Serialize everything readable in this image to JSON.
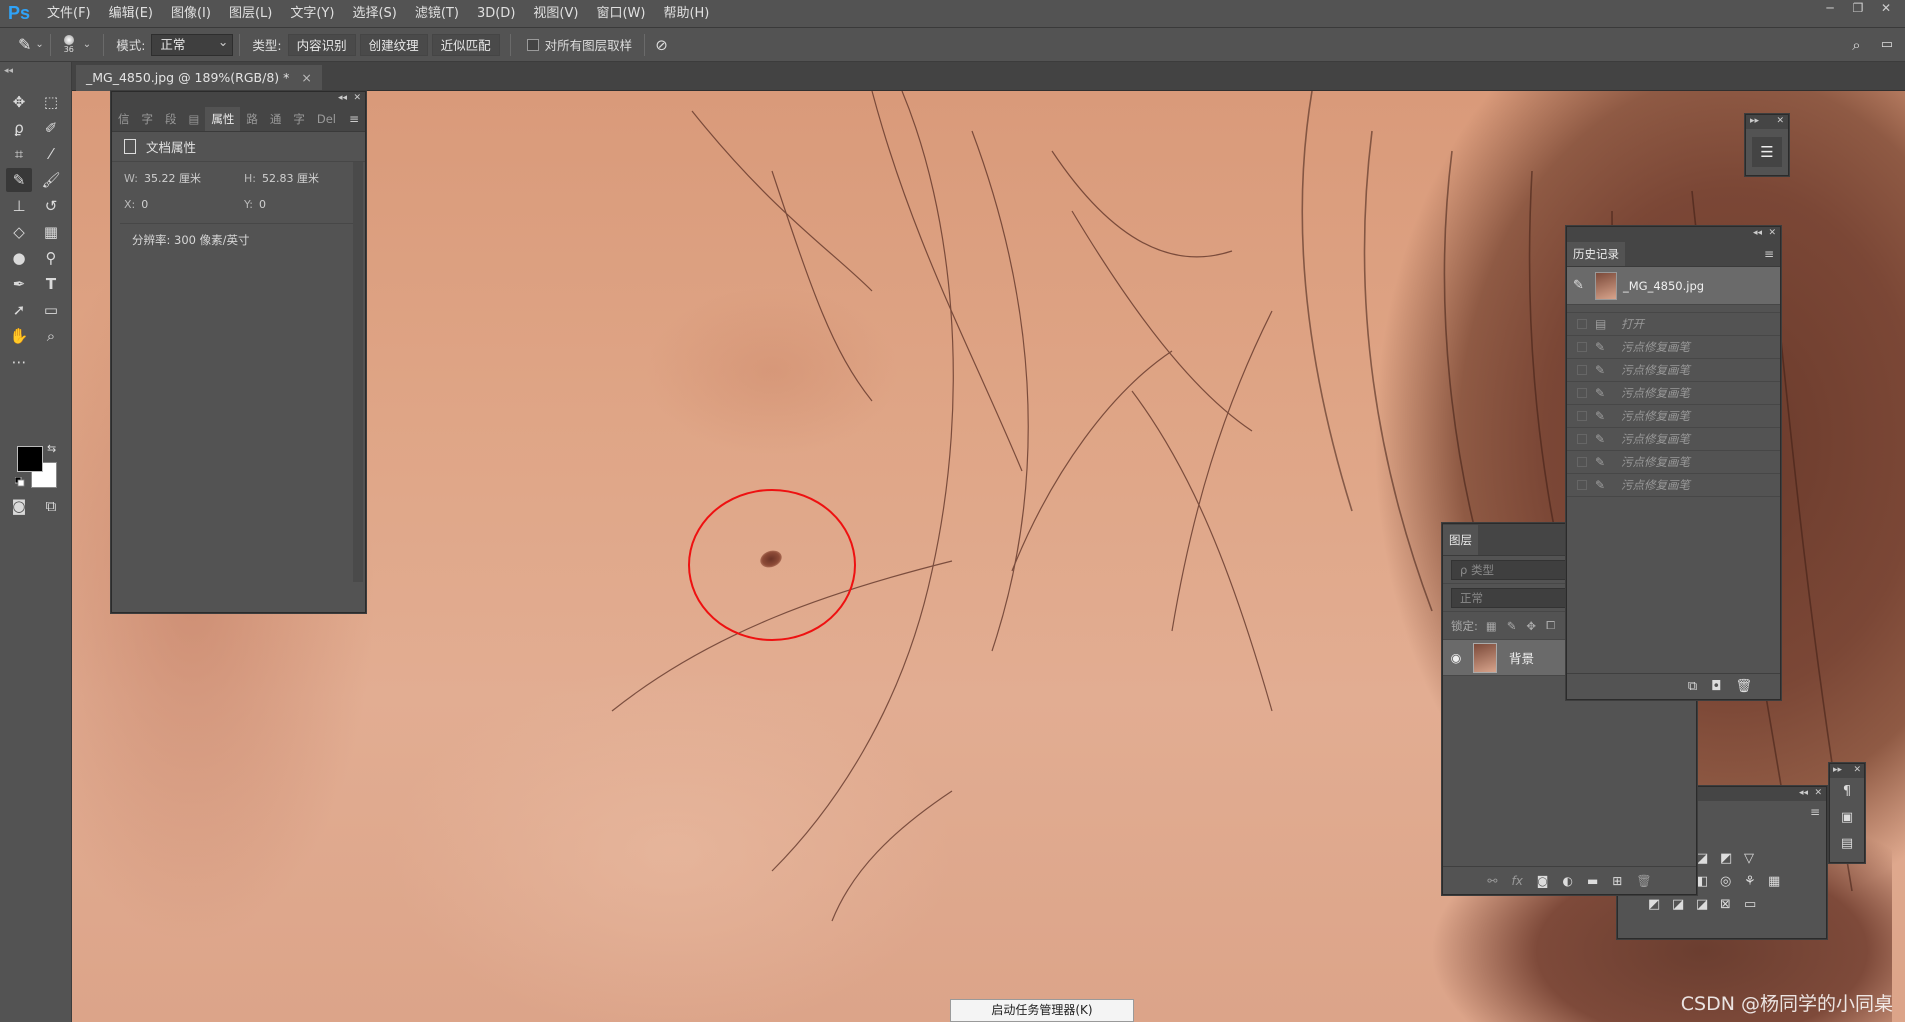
{
  "app": {
    "logo": "Ps"
  },
  "menu": [
    "文件(F)",
    "编辑(E)",
    "图像(I)",
    "图层(L)",
    "文字(Y)",
    "选择(S)",
    "滤镜(T)",
    "3D(D)",
    "视图(V)",
    "窗口(W)",
    "帮助(H)"
  ],
  "window_controls": [
    "─",
    "❐",
    "✕"
  ],
  "options": {
    "brush_size": "36",
    "mode_label": "模式:",
    "mode_value": "正常",
    "type_label": "类型:",
    "type_options": [
      "内容识别",
      "创建纹理",
      "近似匹配"
    ],
    "sample_all_label": "对所有图层取样"
  },
  "document": {
    "tab_title": "_MG_4850.jpg @ 189%(RGB/8) *",
    "close": "×"
  },
  "properties_panel": {
    "tabs": [
      "信",
      "字",
      "段",
      "▤",
      "属性",
      "路",
      "通",
      "字",
      "Del"
    ],
    "header": "文档属性",
    "w_label": "W:",
    "w_value": "35.22 厘米",
    "h_label": "H:",
    "h_value": "52.83 厘米",
    "x_label": "X:",
    "x_value": "0",
    "y_label": "Y:",
    "y_value": "0",
    "resolution": "分辨率: 300 像素/英寸"
  },
  "history_panel": {
    "title": "历史记录",
    "snapshot": "_MG_4850.jpg",
    "items": [
      "打开",
      "污点修复画笔",
      "污点修复画笔",
      "污点修复画笔",
      "污点修复画笔",
      "污点修复画笔",
      "污点修复画笔",
      "污点修复画笔"
    ]
  },
  "layers_panel": {
    "title": "图层",
    "filter_placeholder": "ρ 类型",
    "blend_mode": "正常",
    "lock_label": "锁定:",
    "layer_name": "背景"
  },
  "canvas": {
    "watermark": "CSDN @杨同学的小同桌"
  },
  "taskbar_tip": "启动任务管理器(K)",
  "colors": {
    "foreground": "#000000",
    "background": "#ffffff",
    "mark_circle": "#ee1111",
    "ps_blue": "#2fa3f8"
  }
}
